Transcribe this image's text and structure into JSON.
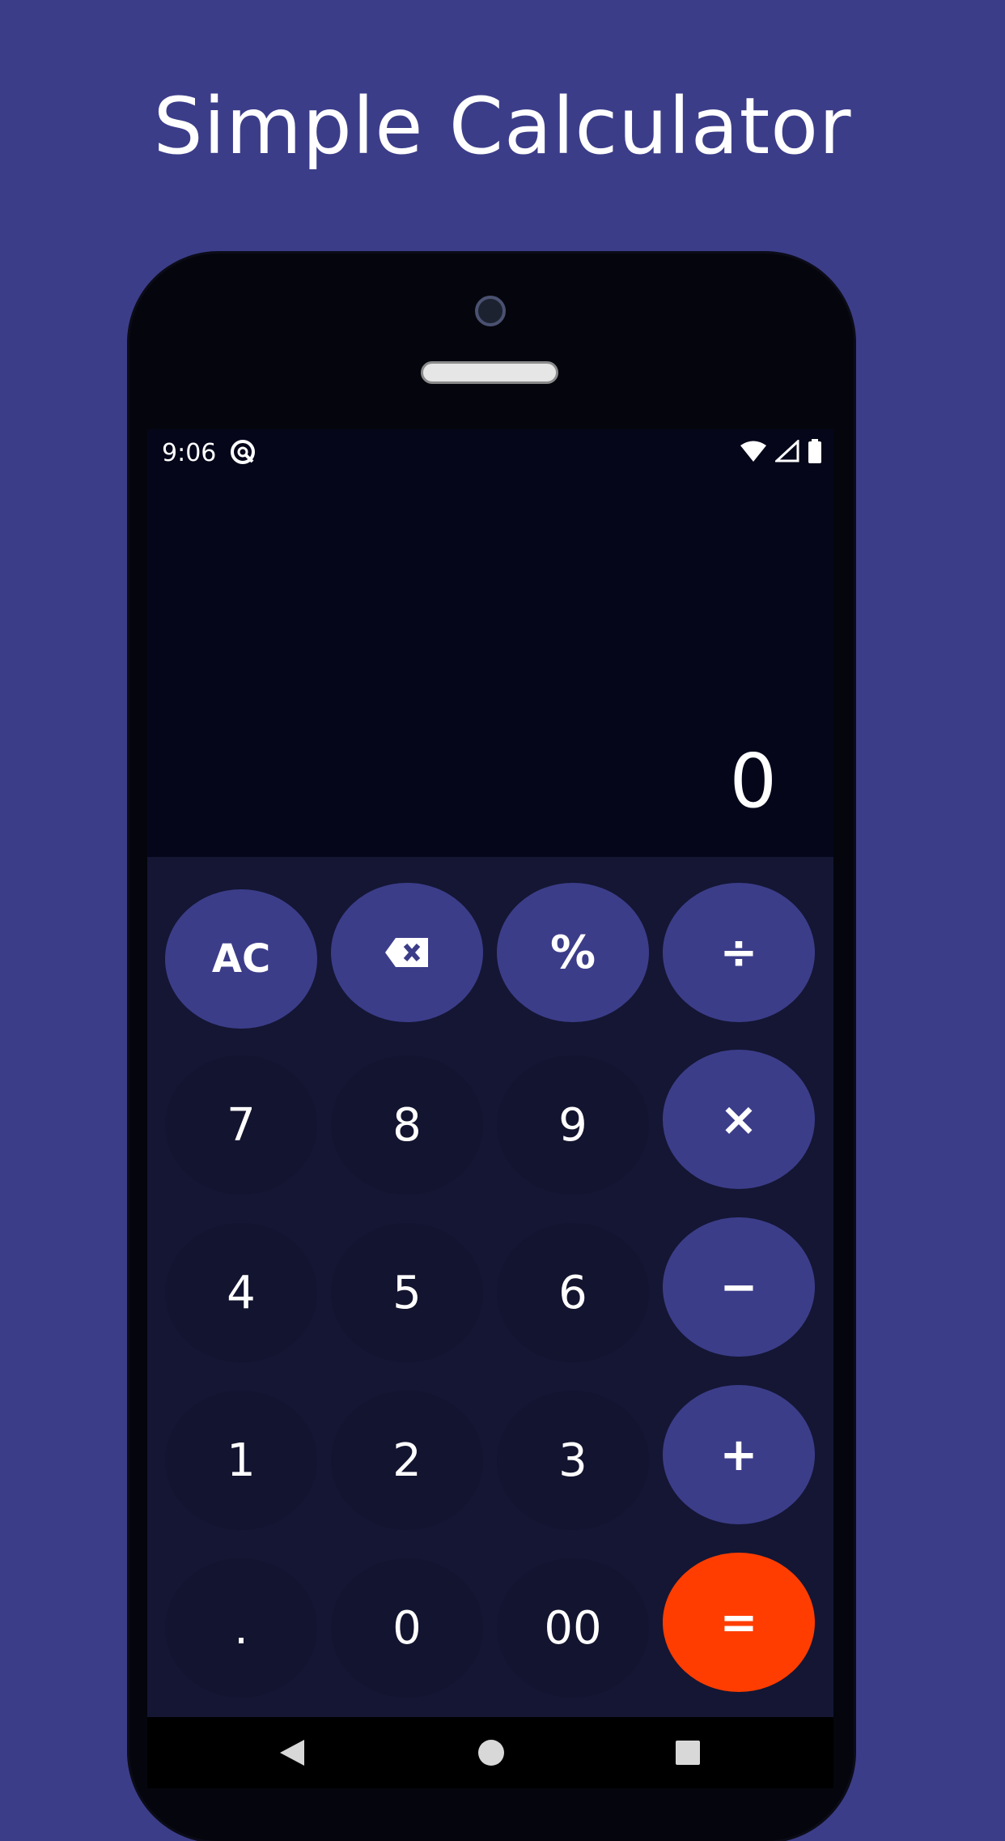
{
  "headline": "Simple Calculator",
  "status": {
    "time": "9:06"
  },
  "display": {
    "value": "0"
  },
  "keys": {
    "ac": "AC",
    "percent": "%",
    "divide": "÷",
    "seven": "7",
    "eight": "8",
    "nine": "9",
    "multiply": "×",
    "four": "4",
    "five": "5",
    "six": "6",
    "minus": "−",
    "one": "1",
    "two": "2",
    "three": "3",
    "plus": "+",
    "dot": ".",
    "zero": "0",
    "double_zero": "00",
    "equals": "="
  },
  "colors": {
    "background": "#3c3d89",
    "operator_key": "#3c3d89",
    "number_key": "#13142f",
    "keypad": "#141634",
    "equals_key": "#ff3d00"
  },
  "icons": [
    "backspace-icon",
    "wifi-icon",
    "signal-icon",
    "battery-icon",
    "back-icon",
    "home-icon",
    "recents-icon"
  ]
}
